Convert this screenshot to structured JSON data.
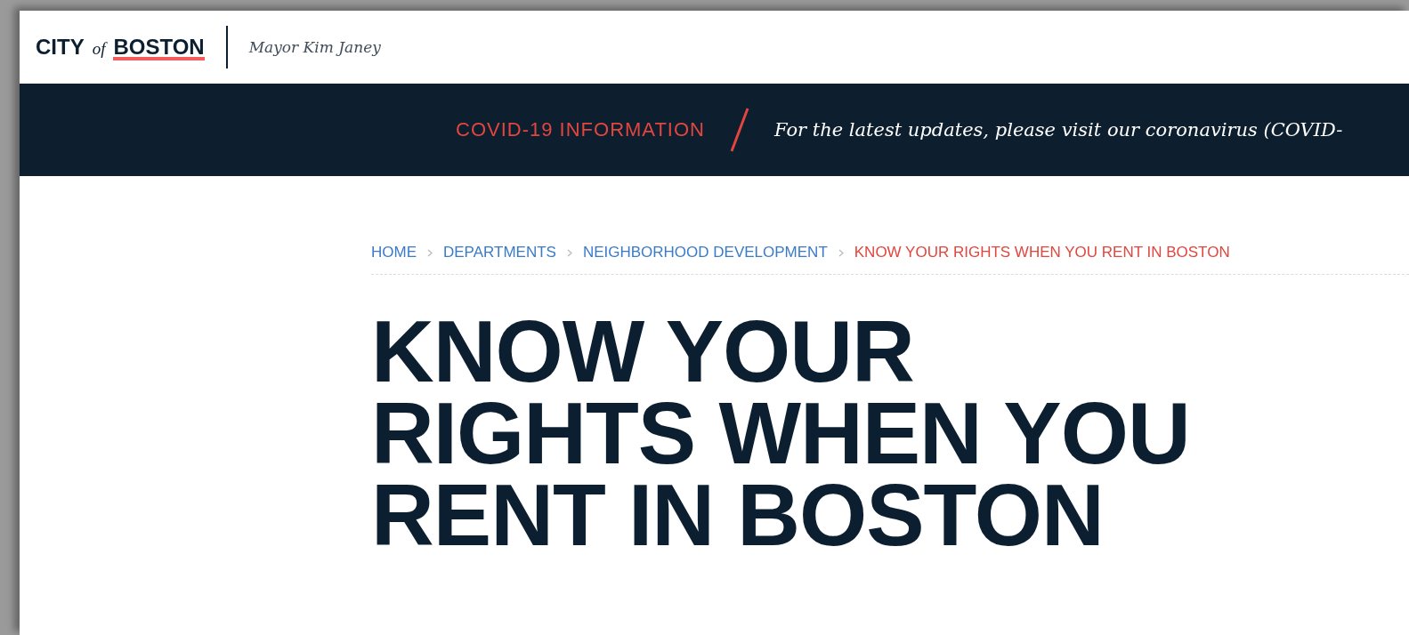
{
  "header": {
    "logo": {
      "part_1": "CITY",
      "part_2": "of",
      "part_3": "BOSTON"
    },
    "mayor": "Mayor Kim Janey"
  },
  "alert_bar": {
    "label": "COVID-19 INFORMATION",
    "message": "For the latest updates, please visit our coronavirus (COVID-"
  },
  "breadcrumb": [
    {
      "label": "HOME",
      "current": false
    },
    {
      "label": "DEPARTMENTS",
      "current": false
    },
    {
      "label": "NEIGHBORHOOD DEVELOPMENT",
      "current": false
    },
    {
      "label": "KNOW YOUR RIGHTS WHEN YOU RENT IN BOSTON",
      "current": true
    }
  ],
  "title_lines": [
    "KNOW YOUR",
    "RIGHTS WHEN YOU",
    "RENT IN BOSTON"
  ]
}
